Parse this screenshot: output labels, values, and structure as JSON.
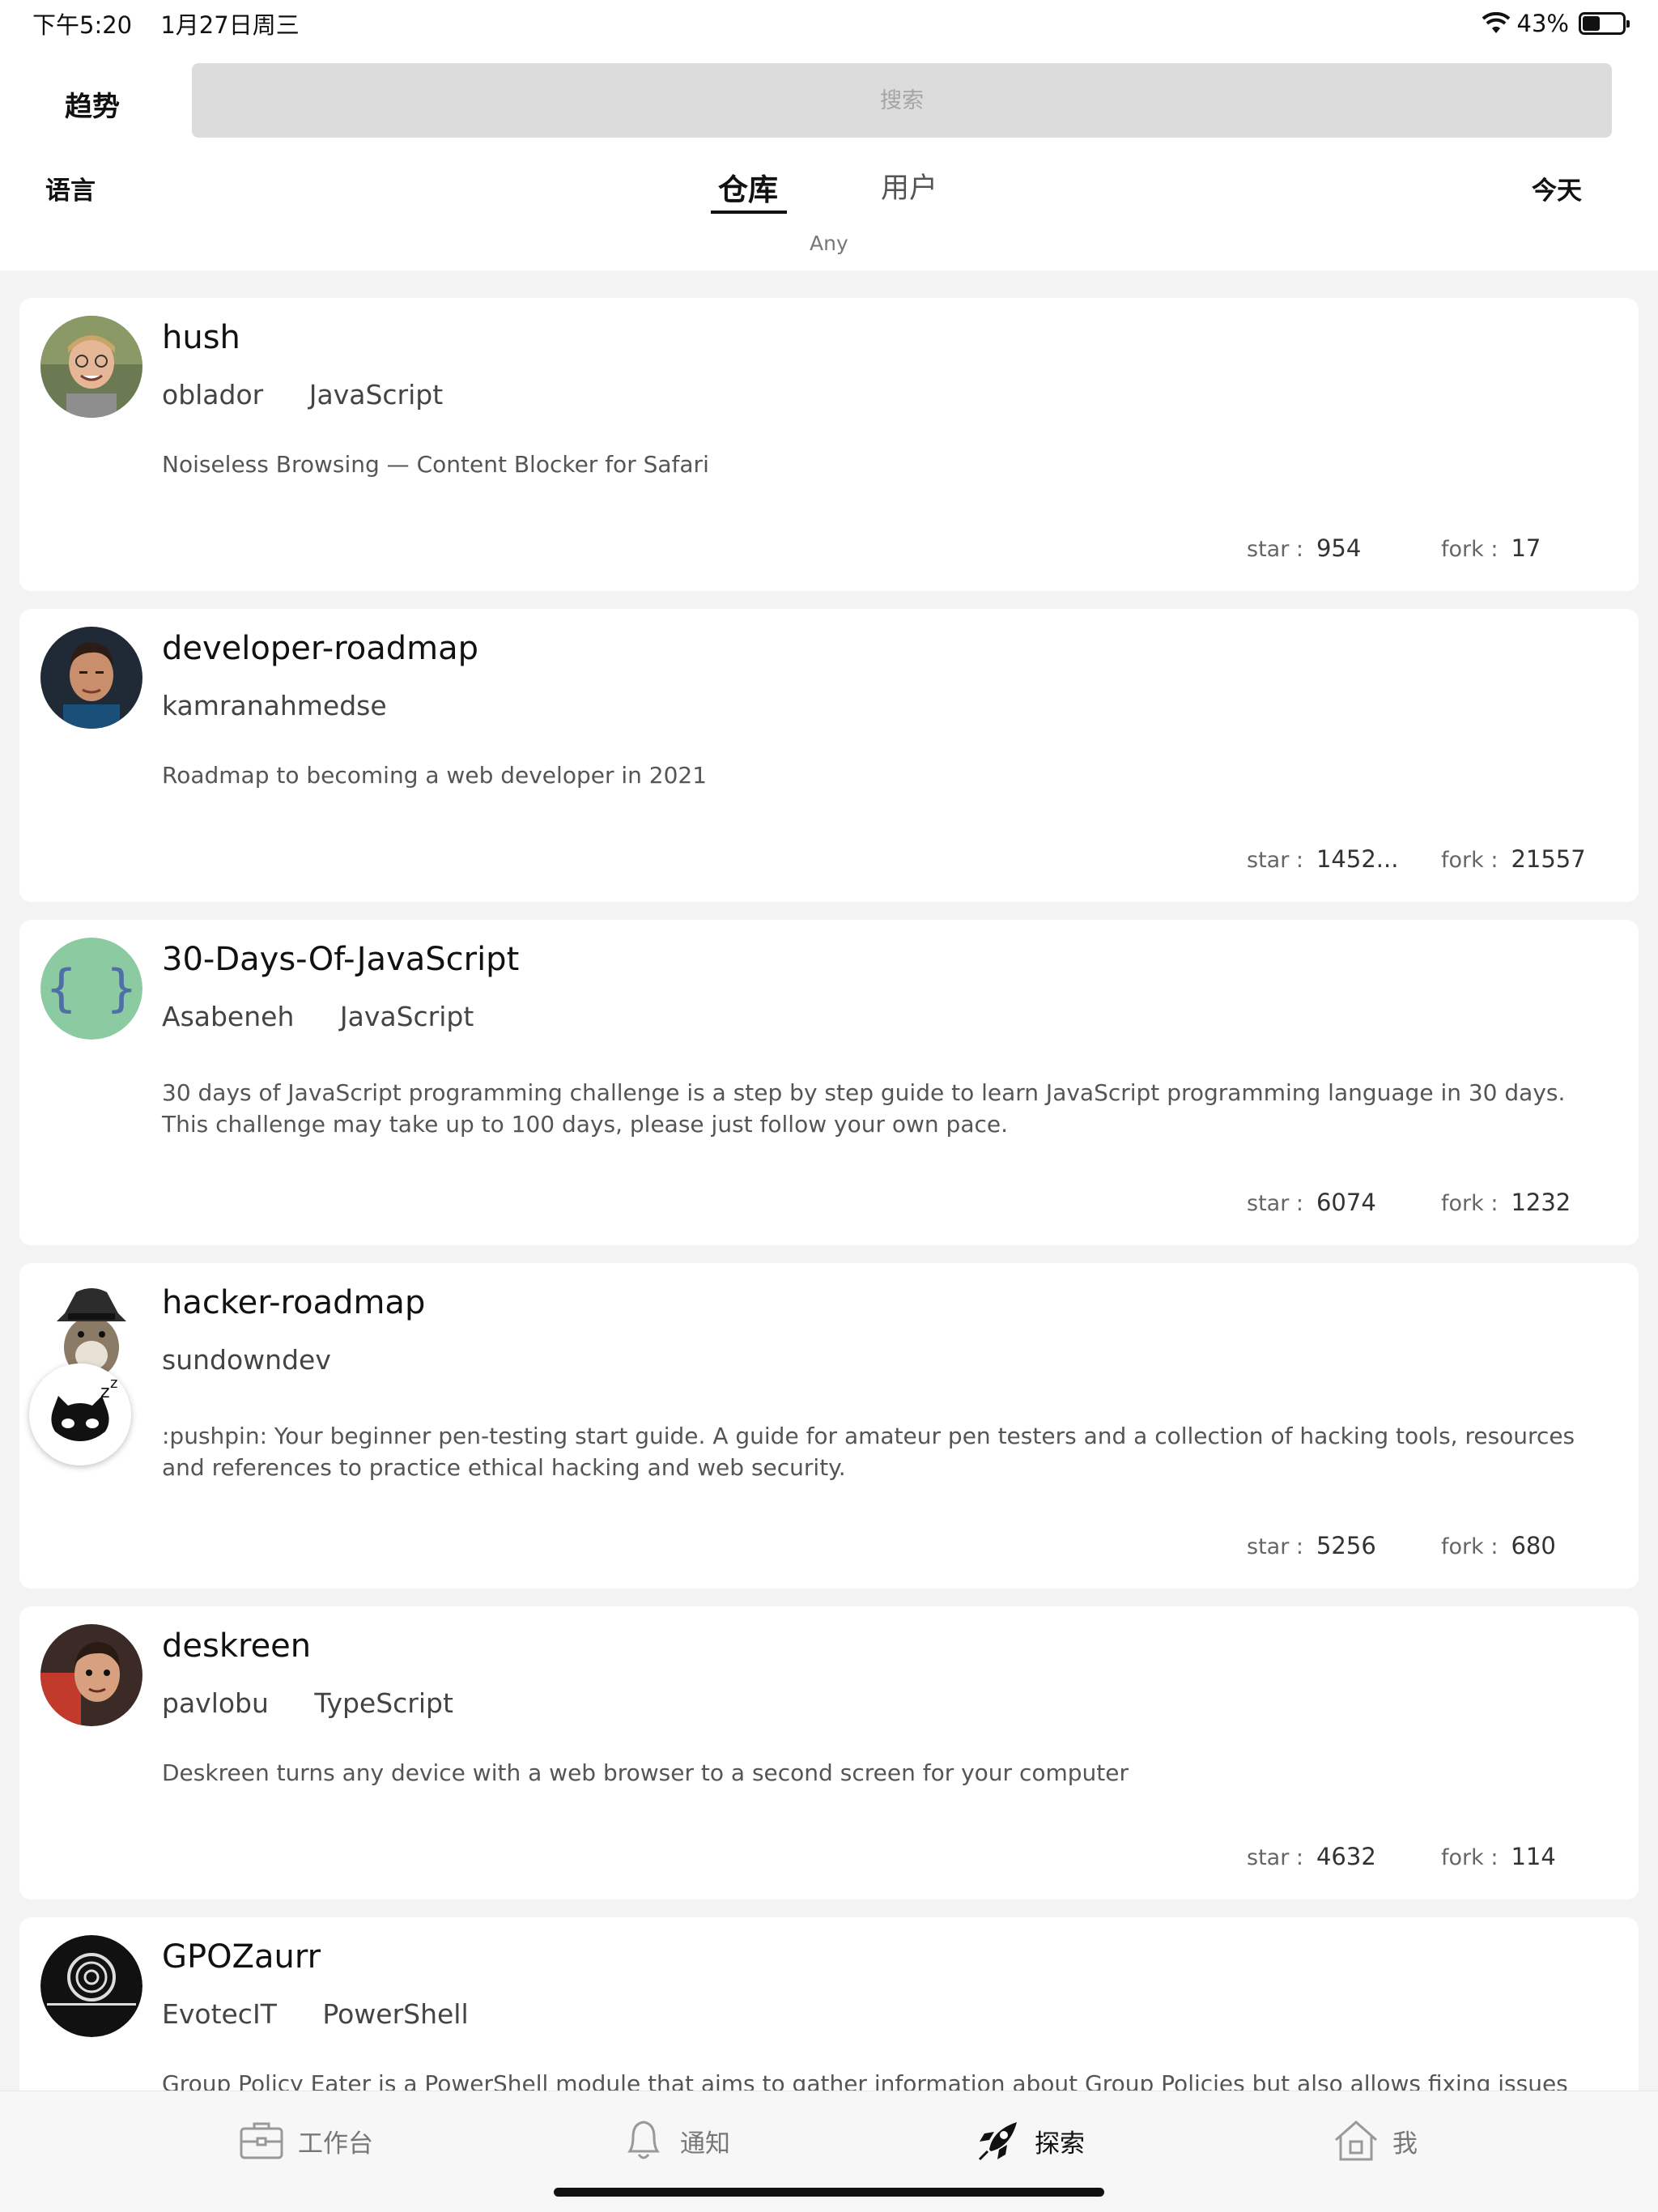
{
  "status": {
    "time": "下午5:20",
    "date": "1月27日周三",
    "battery": "43%",
    "battery_level": 0.43
  },
  "header": {
    "title": "趋势",
    "search_placeholder": "搜索",
    "language_filter": "语言",
    "tabs": [
      {
        "label": "仓库",
        "active": true
      },
      {
        "label": "用户",
        "active": false
      }
    ],
    "time_filter": "今天",
    "language_value": "Any"
  },
  "labels": {
    "star": "star :",
    "fork": "fork :"
  },
  "repos": [
    {
      "name": "hush",
      "owner": "oblador",
      "language": "JavaScript",
      "description": "Noiseless Browsing — Content Blocker for Safari",
      "stars": "954",
      "forks": "17"
    },
    {
      "name": "developer-roadmap",
      "owner": "kamranahmedse",
      "language": "",
      "description": "Roadmap to becoming a web developer in 2021",
      "stars": "1452...",
      "forks": "21557"
    },
    {
      "name": "30-Days-Of-JavaScript",
      "owner": "Asabeneh",
      "language": "JavaScript",
      "description": "30 days of JavaScript programming challenge is a step by step guide to learn JavaScript programming language in 30 days. This challenge may take up to 100 days,  please just follow your own pace.",
      "stars": "6074",
      "forks": "1232"
    },
    {
      "name": "hacker-roadmap",
      "owner": "sundowndev",
      "language": "",
      "description": ":pushpin: Your beginner pen-testing start guide. A guide for amateur pen testers and a collection of hacking tools, resources and references to practice ethical hacking and web security.",
      "stars": "5256",
      "forks": "680"
    },
    {
      "name": "deskreen",
      "owner": "pavlobu",
      "language": "TypeScript",
      "description": "Deskreen turns any device with a web browser to a second screen for your computer",
      "stars": "4632",
      "forks": "114"
    },
    {
      "name": "GPOZaurr",
      "owner": "EvotecIT",
      "language": "PowerShell",
      "description": "Group Policy Eater is a PowerShell module that aims to gather information about Group Policies but also allows fixing issues",
      "stars": "",
      "forks": ""
    }
  ],
  "tabbar": [
    {
      "label": "工作台",
      "icon": "briefcase-icon",
      "active": false
    },
    {
      "label": "通知",
      "icon": "bell-icon",
      "active": false
    },
    {
      "label": "探索",
      "icon": "rocket-icon",
      "active": true
    },
    {
      "label": "我",
      "icon": "home-icon",
      "active": false
    }
  ],
  "colors": {
    "background": "#f3f3f3",
    "card": "#ffffff",
    "search": "#dcdcdc",
    "text": "#111111"
  }
}
